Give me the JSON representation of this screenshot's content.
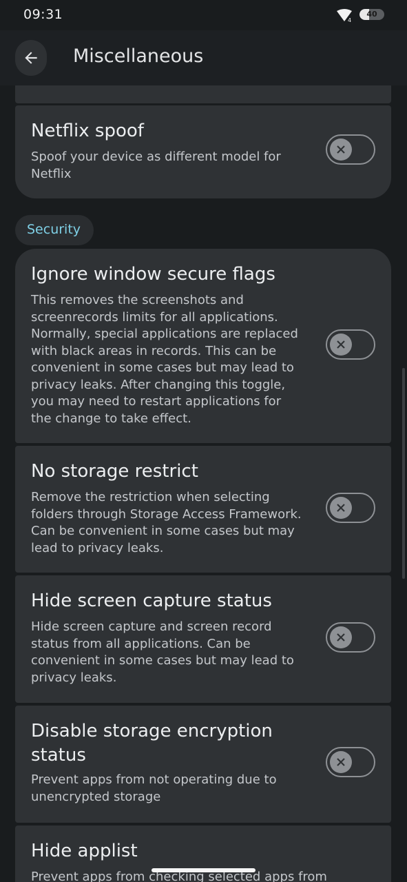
{
  "status_bar": {
    "time": "09:31",
    "battery_level": "40",
    "battery_fraction": 0.4,
    "wifi_badge": "4"
  },
  "header": {
    "title": "Miscellaneous",
    "back_icon": "arrow-left-icon"
  },
  "sections": [
    {
      "label": "Security"
    }
  ],
  "settings": [
    {
      "title": "Netflix spoof",
      "description": "Spoof your device as different model for Netflix",
      "enabled": false
    },
    {
      "title": "Ignore window secure flags",
      "description": "This removes the screenshots and screenrecords limits for all applications. Normally, special applications are replaced with black areas in records. This can be convenient in some cases but may lead to privacy leaks. After changing this toggle, you may need to restart applications for the change to take effect.",
      "enabled": false
    },
    {
      "title": "No storage restrict",
      "description": "Remove the restriction when selecting folders through Storage Access Framework. Can be convenient in some cases but may lead to privacy leaks.",
      "enabled": false
    },
    {
      "title": "Hide screen capture status",
      "description": "Hide screen capture and screen record status from all applications. Can be convenient in some cases but may lead to privacy leaks.",
      "enabled": false
    },
    {
      "title": "Disable storage encryption status",
      "description": "Prevent apps from not operating due to unencrypted storage",
      "enabled": false
    },
    {
      "title": "Hide applist",
      "description": "Prevent apps from checking selected apps from",
      "enabled": false
    }
  ],
  "colors": {
    "background": "#191c1e",
    "card": "#2f3235",
    "accent": "#7fd0e6",
    "toggle_off": "#8e9195"
  }
}
